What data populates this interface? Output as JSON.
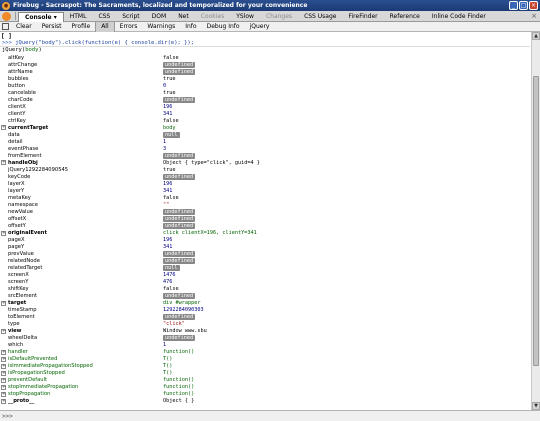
{
  "window": {
    "title": "Firebug - Sacraspot: The Sacraments, localized and temporalized for your convenience"
  },
  "tabs": [
    {
      "label": "Console",
      "state": "active"
    },
    {
      "label": "HTML",
      "state": "normal"
    },
    {
      "label": "CSS",
      "state": "normal"
    },
    {
      "label": "Script",
      "state": "normal"
    },
    {
      "label": "DOM",
      "state": "normal"
    },
    {
      "label": "Net",
      "state": "normal"
    },
    {
      "label": "Cookies",
      "state": "grey"
    },
    {
      "label": "YSlow",
      "state": "normal"
    },
    {
      "label": "Changes",
      "state": "grey"
    },
    {
      "label": "CSS Usage",
      "state": "normal"
    },
    {
      "label": "FireFinder",
      "state": "normal"
    },
    {
      "label": "Reference",
      "state": "normal"
    },
    {
      "label": "Inline Code Finder",
      "state": "normal"
    }
  ],
  "toolbar": [
    {
      "label": "Clear",
      "selected": false
    },
    {
      "label": "Persist",
      "selected": false
    },
    {
      "label": "Profile",
      "selected": false
    },
    {
      "label": "All",
      "selected": true
    },
    {
      "label": "Errors",
      "selected": false
    },
    {
      "label": "Warnings",
      "selected": false
    },
    {
      "label": "Info",
      "selected": false
    },
    {
      "label": "Debug Info",
      "selected": false
    },
    {
      "label": "jQuery",
      "selected": false
    }
  ],
  "console": {
    "bracket": "[ ]",
    "prompt": ">>>",
    "command": "jQuery(\"body\").click(function(e) { console.dir(e); });",
    "object_header_prefix": "jQuery(",
    "object_header_highlight": "body",
    "object_header_suffix": ")"
  },
  "properties": [
    {
      "name": "altKey",
      "value": "false",
      "type": "bool",
      "expandable": false
    },
    {
      "name": "attrChange",
      "value": "undefined",
      "type": "undef",
      "expandable": false
    },
    {
      "name": "attrName",
      "value": "undefined",
      "type": "undef",
      "expandable": false
    },
    {
      "name": "bubbles",
      "value": "true",
      "type": "bool",
      "expandable": false
    },
    {
      "name": "button",
      "value": "0",
      "type": "num",
      "expandable": false
    },
    {
      "name": "cancelable",
      "value": "true",
      "type": "bool",
      "expandable": false
    },
    {
      "name": "charCode",
      "value": "undefined",
      "type": "undef",
      "expandable": false
    },
    {
      "name": "clientX",
      "value": "196",
      "type": "num",
      "expandable": false
    },
    {
      "name": "clientY",
      "value": "341",
      "type": "num",
      "expandable": false
    },
    {
      "name": "ctrlKey",
      "value": "false",
      "type": "bool",
      "expandable": false
    },
    {
      "name": "currentTarget",
      "value": "body",
      "type": "node",
      "expandable": true
    },
    {
      "name": "data",
      "value": "null",
      "type": "undef",
      "expandable": false
    },
    {
      "name": "detail",
      "value": "1",
      "type": "num",
      "expandable": false
    },
    {
      "name": "eventPhase",
      "value": "3",
      "type": "num",
      "expandable": false
    },
    {
      "name": "fromElement",
      "value": "undefined",
      "type": "undef",
      "expandable": false
    },
    {
      "name": "handleObj",
      "value": "Object { type=\"click\",  guid=4 }",
      "type": "objv",
      "expandable": true
    },
    {
      "name": "jQuery1292284090545",
      "value": "true",
      "type": "bool",
      "expandable": false
    },
    {
      "name": "keyCode",
      "value": "undefined",
      "type": "undef",
      "expandable": false
    },
    {
      "name": "layerX",
      "value": "196",
      "type": "num",
      "expandable": false
    },
    {
      "name": "layerY",
      "value": "341",
      "type": "num",
      "expandable": false
    },
    {
      "name": "metaKey",
      "value": "false",
      "type": "bool",
      "expandable": false
    },
    {
      "name": "namespace",
      "value": "\"\"",
      "type": "str",
      "expandable": false
    },
    {
      "name": "newValue",
      "value": "undefined",
      "type": "undef",
      "expandable": false
    },
    {
      "name": "offsetX",
      "value": "undefined",
      "type": "undef",
      "expandable": false
    },
    {
      "name": "offsetY",
      "value": "undefined",
      "type": "undef",
      "expandable": false
    },
    {
      "name": "originalEvent",
      "value": "click clientX=196, clientY=341",
      "type": "node",
      "expandable": true
    },
    {
      "name": "pageX",
      "value": "196",
      "type": "num",
      "expandable": false
    },
    {
      "name": "pageY",
      "value": "341",
      "type": "num",
      "expandable": false
    },
    {
      "name": "prevValue",
      "value": "undefined",
      "type": "undef",
      "expandable": false
    },
    {
      "name": "relatedNode",
      "value": "undefined",
      "type": "undef",
      "expandable": false
    },
    {
      "name": "relatedTarget",
      "value": "null",
      "type": "undef",
      "expandable": false
    },
    {
      "name": "screenX",
      "value": "1476",
      "type": "num",
      "expandable": false
    },
    {
      "name": "screenY",
      "value": "476",
      "type": "num",
      "expandable": false
    },
    {
      "name": "shiftKey",
      "value": "false",
      "type": "bool",
      "expandable": false
    },
    {
      "name": "srcElement",
      "value": "undefined",
      "type": "undef",
      "expandable": false
    },
    {
      "name": "target",
      "value": "div #wrapper",
      "type": "node",
      "expandable": true
    },
    {
      "name": "timeStamp",
      "value": "1292284090303",
      "type": "num",
      "expandable": false
    },
    {
      "name": "toElement",
      "value": "undefined",
      "type": "undef",
      "expandable": false
    },
    {
      "name": "type",
      "value": "\"click\"",
      "type": "str",
      "expandable": false
    },
    {
      "name": "view",
      "value": "Window www.sbu",
      "type": "objv",
      "expandable": true
    },
    {
      "name": "wheelDelta",
      "value": "undefined",
      "type": "undef",
      "expandable": false
    },
    {
      "name": "which",
      "value": "1",
      "type": "num",
      "expandable": false
    },
    {
      "name": "handler",
      "value": "function()",
      "type": "fnv",
      "expandable": true,
      "fn": true
    },
    {
      "name": "isDefaultPrevented",
      "value": "T()",
      "type": "fnv",
      "expandable": true,
      "fn": true
    },
    {
      "name": "isImmediatePropagationStopped",
      "value": "T()",
      "type": "fnv",
      "expandable": true,
      "fn": true
    },
    {
      "name": "isPropagationStopped",
      "value": "T()",
      "type": "fnv",
      "expandable": true,
      "fn": true
    },
    {
      "name": "preventDefault",
      "value": "function()",
      "type": "fnv",
      "expandable": true,
      "fn": true
    },
    {
      "name": "stopImmediatePropagation",
      "value": "function()",
      "type": "fnv",
      "expandable": true,
      "fn": true
    },
    {
      "name": "stopPropagation",
      "value": "function()",
      "type": "fnv",
      "expandable": true,
      "fn": true
    },
    {
      "name": "__proto__",
      "value": "Object { }",
      "type": "objv",
      "expandable": true
    }
  ],
  "statusbar": {
    "left": ">>>"
  }
}
